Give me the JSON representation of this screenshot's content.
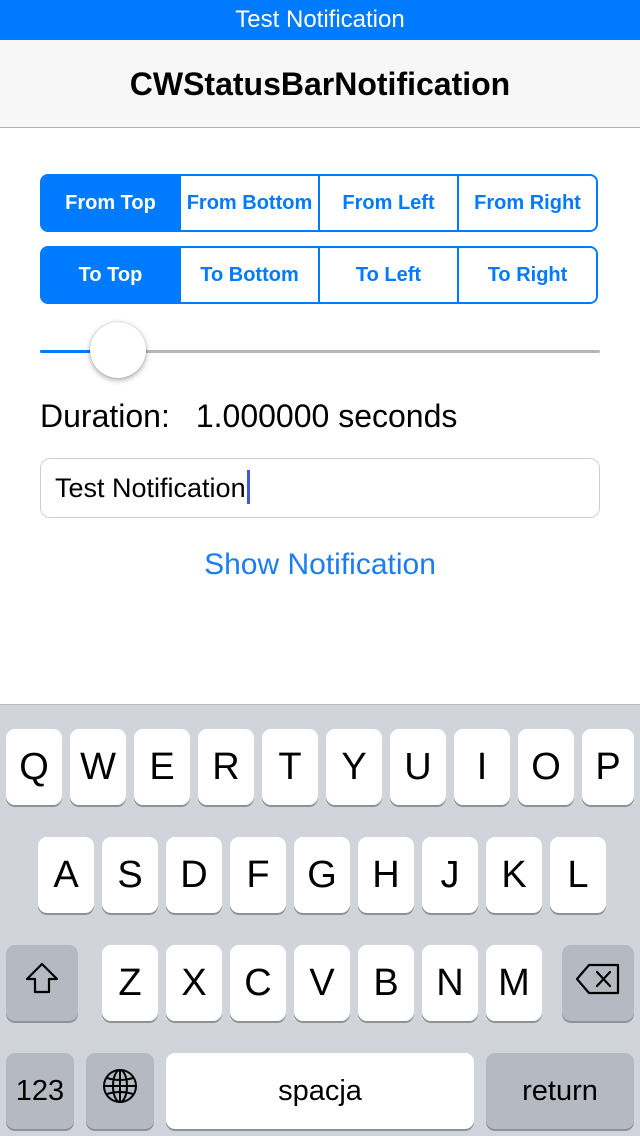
{
  "status_bar": {
    "text": "Test Notification"
  },
  "nav": {
    "title": "CWStatusBarNotification"
  },
  "from_segments": [
    "From Top",
    "From Bottom",
    "From Left",
    "From Right"
  ],
  "to_segments": [
    "To Top",
    "To Bottom",
    "To Left",
    "To Right"
  ],
  "selected_from": 0,
  "selected_to": 0,
  "slider": {
    "fraction": 0.1
  },
  "duration": {
    "label": "Duration:",
    "value": "1.000000 seconds"
  },
  "text_field": {
    "value": "Test Notification"
  },
  "show_button": {
    "label": "Show Notification"
  },
  "keyboard": {
    "row1": [
      "Q",
      "W",
      "E",
      "R",
      "T",
      "Y",
      "U",
      "I",
      "O",
      "P"
    ],
    "row2": [
      "A",
      "S",
      "D",
      "F",
      "G",
      "H",
      "J",
      "K",
      "L"
    ],
    "row3": [
      "Z",
      "X",
      "C",
      "V",
      "B",
      "N",
      "M"
    ],
    "numbers_label": "123",
    "space_label": "spacja",
    "return_label": "return"
  },
  "colors": {
    "accent": "#007aff",
    "keyboard_bg": "#d1d5db",
    "dark_key": "#b5bac2"
  },
  "icons": {
    "shift": "shift-icon",
    "delete": "delete-icon",
    "globe": "globe-icon"
  }
}
